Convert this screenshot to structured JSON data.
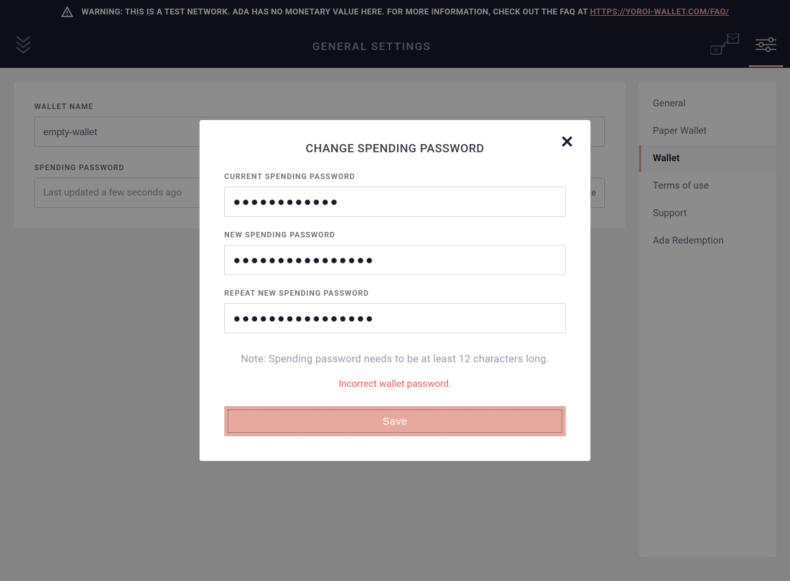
{
  "warning": {
    "text": "WARNING: THIS IS A TEST NETWORK. ADA HAS NO MONETARY VALUE HERE. FOR MORE INFORMATION, CHECK OUT THE FAQ AT ",
    "link_text": "HTTPS://YOROI-WALLET.COM/FAQ/"
  },
  "header": {
    "title": "GENERAL SETTINGS"
  },
  "main": {
    "wallet_name_label": "WALLET NAME",
    "wallet_name_value": "empty-wallet",
    "spending_password_label": "SPENDING PASSWORD",
    "spending_password_status": "Last updated a few seconds ago",
    "spending_password_change": "change"
  },
  "sidebar": {
    "items": [
      {
        "label": "General"
      },
      {
        "label": "Paper Wallet"
      },
      {
        "label": "Wallet"
      },
      {
        "label": "Terms of use"
      },
      {
        "label": "Support"
      },
      {
        "label": "Ada Redemption"
      }
    ]
  },
  "modal": {
    "title": "CHANGE SPENDING PASSWORD",
    "current_label": "CURRENT SPENDING PASSWORD",
    "current_value": "●●●●●●●●●●●●",
    "new_label": "NEW SPENDING PASSWORD",
    "new_value": "●●●●●●●●●●●●●●●●",
    "repeat_label": "REPEAT NEW SPENDING PASSWORD",
    "repeat_value": "●●●●●●●●●●●●●●●●",
    "note": "Note: Spending password needs to be at least 12 characters long.",
    "error": "Incorrect wallet password.",
    "save_label": "Save"
  }
}
